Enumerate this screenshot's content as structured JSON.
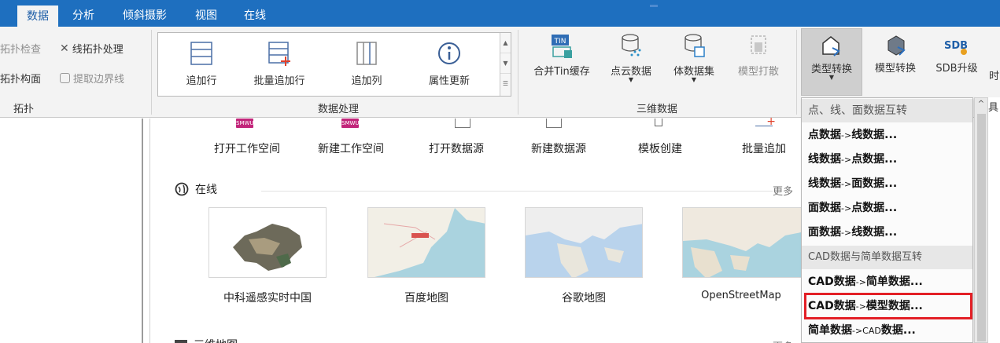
{
  "tabs": [
    "数据",
    "分析",
    "倾斜摄影",
    "视图",
    "在线"
  ],
  "ribbon": {
    "topology": {
      "items": [
        {
          "label": "拓扑检查",
          "disabled": true
        },
        {
          "label": "线拓扑处理",
          "disabled": false
        },
        {
          "label": "拓扑构面",
          "disabled": false
        },
        {
          "label": "提取边界线",
          "disabled": true
        }
      ],
      "group_label": "拓扑"
    },
    "data_processing": {
      "buttons": [
        "追加行",
        "批量追加行",
        "追加列",
        "属性更新"
      ],
      "group_label": "数据处理"
    },
    "three_d": {
      "buttons": [
        {
          "label": "合并Tin缓存",
          "icon_text": "TIN",
          "disabled": false
        },
        {
          "label": "点云数据",
          "disabled": false
        },
        {
          "label": "体数据集",
          "disabled": false
        },
        {
          "label": "模型打散",
          "disabled": true
        }
      ],
      "group_label": "三维数据"
    },
    "conversion": {
      "buttons": [
        {
          "label": "类型转换",
          "pressed": true
        },
        {
          "label": "模型转换"
        },
        {
          "label": "SDB升级",
          "icon_text": "SDB"
        },
        {
          "label": "时"
        }
      ]
    }
  },
  "startpage": {
    "quick_actions": [
      "打开工作空间",
      "新建工作空间",
      "打开数据源",
      "新建数据源",
      "模板创建",
      "批量追加"
    ],
    "smwu_badge": "SMWU",
    "online": {
      "title": "在线",
      "more": "更多",
      "maps": [
        "中科遥感实时中国",
        "百度地图",
        "谷歌地图",
        "OpenStreetMap"
      ]
    },
    "section2_title": "三维地图",
    "section2_more": "更多"
  },
  "dropdown": {
    "header1": "点、线、面数据互转",
    "group1": [
      [
        "点数据",
        "->",
        "线数据..."
      ],
      [
        "线数据",
        "->",
        "点数据..."
      ],
      [
        "线数据",
        "->",
        "面数据..."
      ],
      [
        "面数据",
        "->",
        "点数据..."
      ],
      [
        "面数据",
        "->",
        "线数据..."
      ]
    ],
    "header2": "CAD数据与简单数据互转",
    "group2": [
      [
        "CAD数据",
        "->",
        "简单数据..."
      ],
      [
        "CAD数据",
        "->",
        "模型数据..."
      ],
      [
        "简单数据",
        "->CAD",
        "数据..."
      ]
    ],
    "highlighted_index": 1
  },
  "right_edge_text": "具",
  "colors": {
    "tabbar": "#1e6fbf",
    "highlight": "#e31f26",
    "smwu": "#c2257a"
  }
}
